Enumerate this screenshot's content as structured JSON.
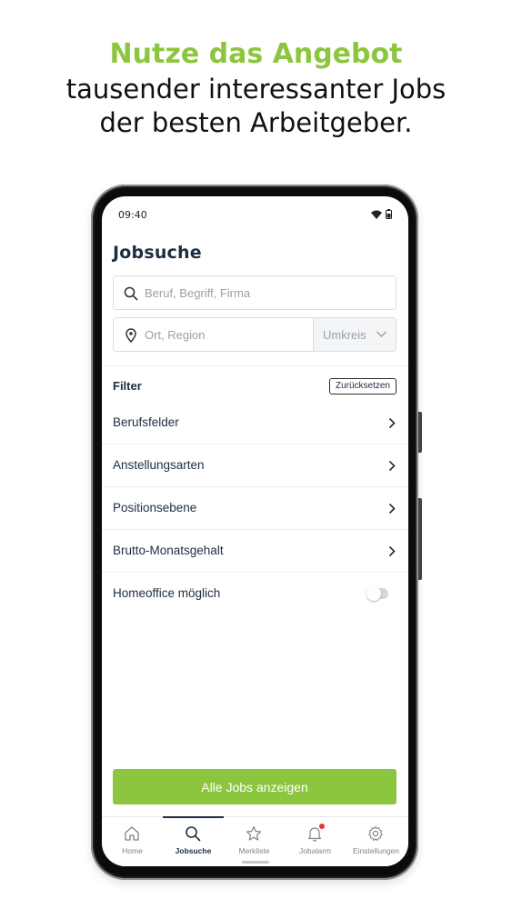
{
  "promo": {
    "headline_accent": "Nutze das Angebot",
    "headline_line1": "tausender interessanter Jobs",
    "headline_line2": "der besten Arbeitgeber."
  },
  "status_bar": {
    "time": "09:40",
    "icons": [
      "wifi-icon",
      "battery-icon"
    ]
  },
  "page": {
    "title": "Jobsuche"
  },
  "search": {
    "keyword_placeholder": "Beruf, Begriff, Firma",
    "location_placeholder": "Ort, Region",
    "radius_label": "Umkreis"
  },
  "filter": {
    "label": "Filter",
    "reset_label": "Zurücksetzen",
    "items": [
      {
        "label": "Berufsfelder"
      },
      {
        "label": "Anstellungsarten"
      },
      {
        "label": "Positionsebene"
      },
      {
        "label": "Brutto-Monatsgehalt"
      }
    ],
    "homeoffice_label": "Homeoffice möglich",
    "homeoffice_enabled": false
  },
  "cta": {
    "label": "Alle Jobs anzeigen"
  },
  "tabbar": {
    "tabs": [
      {
        "label": "Home",
        "icon": "home-icon"
      },
      {
        "label": "Jobsuche",
        "icon": "search-icon",
        "active": true
      },
      {
        "label": "Merkliste",
        "icon": "star-icon"
      },
      {
        "label": "Jobalarm",
        "icon": "bell-icon",
        "badge": true
      },
      {
        "label": "Einstellungen",
        "icon": "gear-icon"
      }
    ]
  },
  "colors": {
    "accent": "#8cc63f",
    "text_dark": "#1e2d40",
    "badge": "#e53935"
  }
}
